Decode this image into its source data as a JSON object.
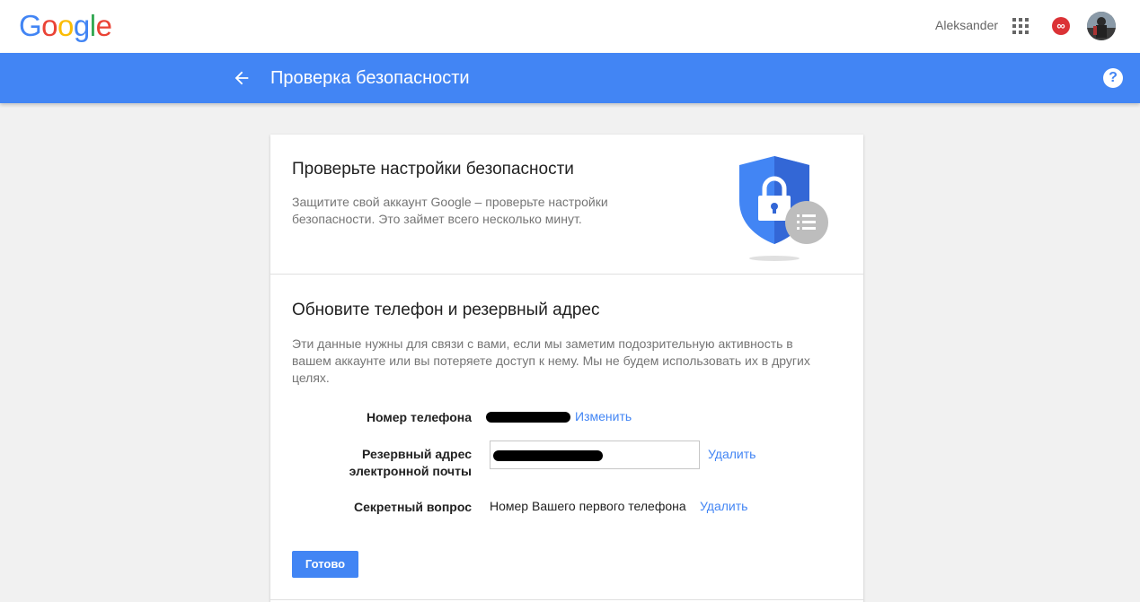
{
  "header": {
    "logo_letters": [
      "G",
      "o",
      "o",
      "g",
      "l",
      "e"
    ],
    "user_name": "Aleksander",
    "notification_glyph": "∞"
  },
  "app_bar": {
    "title": "Проверка безопасности",
    "help_glyph": "?"
  },
  "card": {
    "security_title": "Проверьте настройки безопасности",
    "security_intro": "Защитите свой аккаунт Google – проверьте настройки безопасности. Это займет всего несколько минут.",
    "recovery_title": "Обновите телефон и резервный адрес",
    "recovery_description": "Эти данные нужны для связи с вами, если мы заметим подозрительную активность в вашем аккаунте или вы потеряете доступ к нему. Мы не будем использовать их в других целях.",
    "phone": {
      "label": "Номер телефона",
      "action": "Изменить"
    },
    "backup_email": {
      "label": "Резервный адрес электронной почты",
      "action": "Удалить"
    },
    "secret_question": {
      "label": "Секретный вопрос",
      "value": "Номер Вашего первого телефона",
      "action": "Удалить"
    },
    "done_button": "Готово"
  },
  "colors": {
    "brand_blue": "#4285f4",
    "notification_red": "#db3236",
    "logo": [
      "#4285f4",
      "#ea4335",
      "#fbbc05",
      "#4285f4",
      "#34a853",
      "#ea4335"
    ]
  }
}
